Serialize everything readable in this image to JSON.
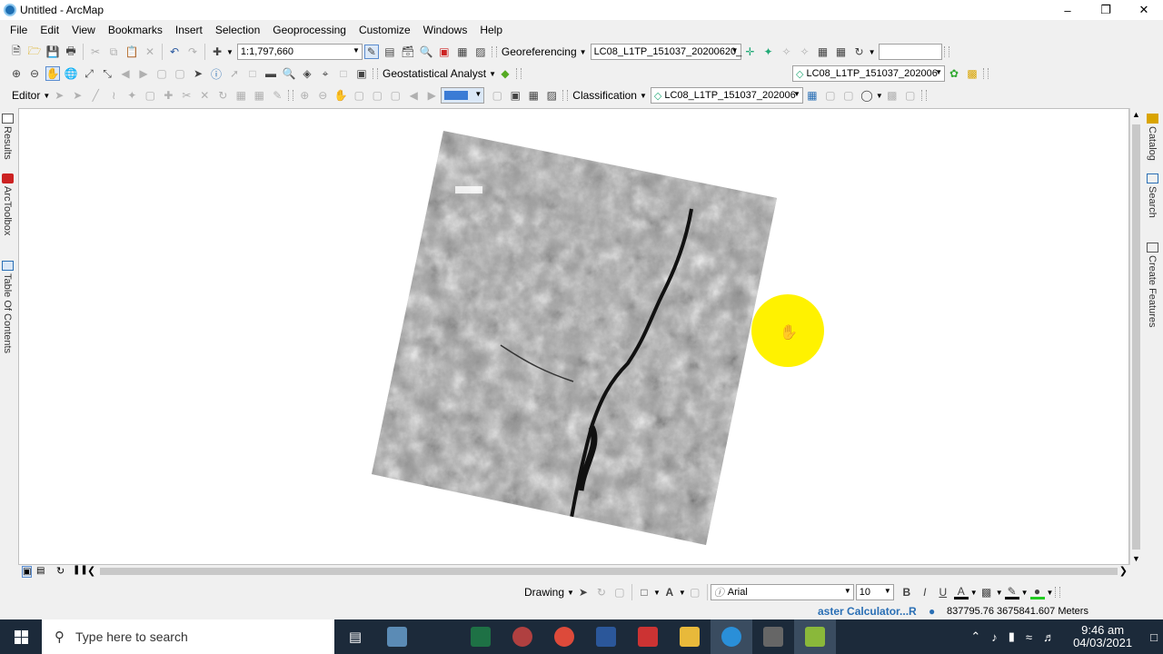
{
  "window": {
    "title": "Untitled - ArcMap"
  },
  "menu": [
    "File",
    "Edit",
    "View",
    "Bookmarks",
    "Insert",
    "Selection",
    "Geoprocessing",
    "Customize",
    "Windows",
    "Help"
  ],
  "toolbar1": {
    "scale": "1:1,797,660",
    "georef_label": "Georeferencing",
    "georef_layer": "LC08_L1TP_151037_20200620_",
    "blank_combo": ""
  },
  "toolbar2": {
    "geostat_label": "Geostatistical Analyst",
    "layer2": "LC08_L1TP_151037_202006"
  },
  "toolbar3": {
    "editor_label": "Editor",
    "classification_label": "Classification",
    "layer3": "LC08_L1TP_151037_202006"
  },
  "dock_left": [
    "Results",
    "ArcToolbox",
    "Table Of Contents"
  ],
  "dock_right": [
    "Catalog",
    "Search",
    "Create Features"
  ],
  "drawing": {
    "label": "Drawing",
    "font": "Arial",
    "size": "10",
    "bold": "B",
    "italic": "I",
    "underline": "U",
    "font_color": "A"
  },
  "status": {
    "process": "aster Calculator...R",
    "coords": "837795.76  3675841.607 Meters"
  },
  "taskbar": {
    "search_placeholder": "Type here to search",
    "time": "9:46 am",
    "date": "04/03/2021"
  },
  "colors": {
    "cursor_highlight": "#fff200",
    "taskbar": "#1c2a3a",
    "accent": "#1f6fb3"
  }
}
